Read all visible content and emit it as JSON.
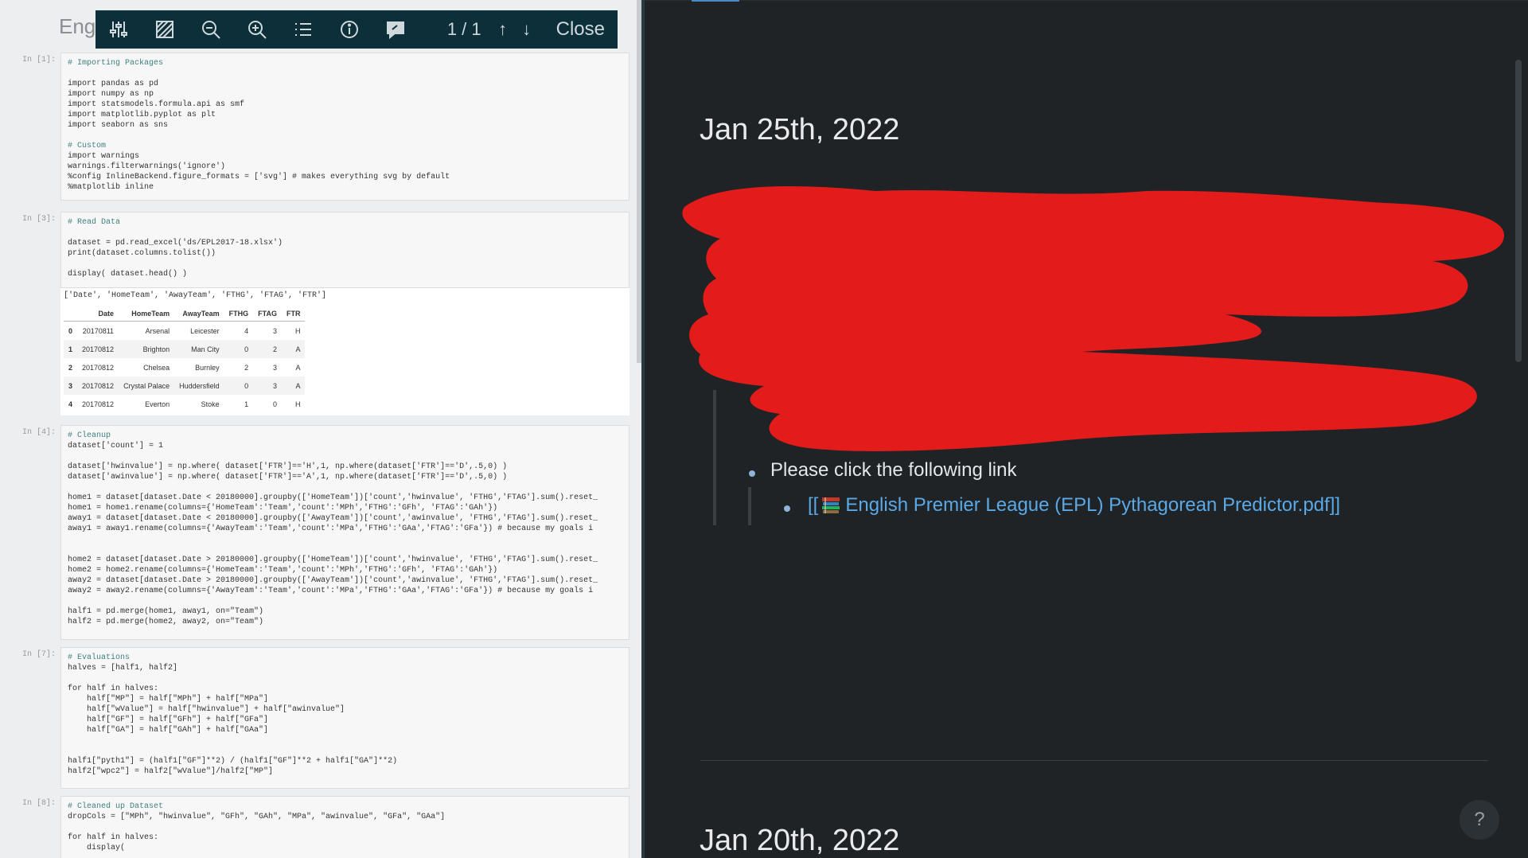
{
  "pdf_viewer": {
    "doc_title": "Engl",
    "toolbar": {
      "icons": [
        "sliders-icon",
        "highlighter-icon",
        "zoom-out-icon",
        "zoom-in-icon",
        "outline-icon",
        "info-icon",
        "comment-icon"
      ],
      "page_indicator": "1 / 1",
      "prev_label": "↑",
      "next_label": "↓",
      "close_label": "Close"
    },
    "cells": [
      {
        "prompt": "In [1]:",
        "lines": [
          "# Importing Packages",
          "",
          "import pandas as pd",
          "import numpy as np",
          "import statsmodels.formula.api as smf",
          "import matplotlib.pyplot as plt",
          "import seaborn as sns",
          "",
          "# Custom",
          "import warnings",
          "warnings.filterwarnings('ignore')",
          "%config InlineBackend.figure_formats = ['svg'] # makes everything svg by default",
          "%matplotlib inline"
        ]
      },
      {
        "prompt": "In [3]:",
        "lines": [
          "# Read Data",
          "",
          "dataset = pd.read_excel('ds/EPL2017-18.xlsx')",
          "print(dataset.columns.tolist())",
          "",
          "display( dataset.head() )"
        ]
      },
      {
        "prompt": "In [4]:",
        "lines": [
          "# Cleanup",
          "dataset['count'] = 1",
          "",
          "dataset['hwinvalue'] = np.where( dataset['FTR']=='H',1, np.where(dataset['FTR']=='D',.5,0) )",
          "dataset['awinvalue'] = np.where( dataset['FTR']=='A',1, np.where(dataset['FTR']=='D',.5,0) )",
          "",
          "home1 = dataset[dataset.Date < 20180000].groupby(['HomeTeam'])['count','hwinvalue', 'FTHG','FTAG'].sum().reset_",
          "home1 = home1.rename(columns={'HomeTeam':'Team','count':'MPh','FTHG':'GFh', 'FTAG':'GAh'})",
          "away1 = dataset[dataset.Date < 20180000].groupby(['AwayTeam'])['count','awinvalue', 'FTHG','FTAG'].sum().reset_",
          "away1 = away1.rename(columns={'AwayTeam':'Team','count':'MPa','FTHG':'GAa','FTAG':'GFa'}) # because my goals i",
          "",
          "",
          "home2 = dataset[dataset.Date > 20180000].groupby(['HomeTeam'])['count','hwinvalue', 'FTHG','FTAG'].sum().reset_",
          "home2 = home2.rename(columns={'HomeTeam':'Team','count':'MPh','FTHG':'GFh', 'FTAG':'GAh'})",
          "away2 = dataset[dataset.Date > 20180000].groupby(['AwayTeam'])['count','awinvalue', 'FTHG','FTAG'].sum().reset_",
          "away2 = away2.rename(columns={'AwayTeam':'Team','count':'MPa','FTHG':'GAa','FTAG':'GFa'}) # because my goals i",
          "",
          "half1 = pd.merge(home1, away1, on=\"Team\")",
          "half2 = pd.merge(home2, away2, on=\"Team\")"
        ]
      },
      {
        "prompt": "In [7]:",
        "lines": [
          "# Evaluations",
          "halves = [half1, half2]",
          "",
          "for half in halves:",
          "    half[\"MP\"] = half[\"MPh\"] + half[\"MPa\"]",
          "    half[\"wValue\"] = half[\"hwinvalue\"] + half[\"awinvalue\"]",
          "    half[\"GF\"] = half[\"GFh\"] + half[\"GFa\"]",
          "    half[\"GA\"] = half[\"GAh\"] + half[\"GAa\"]",
          "",
          "",
          "half1[\"pyth1\"] = (half1[\"GF\"]**2) / (half1[\"GF\"]**2 + half1[\"GA\"]**2)",
          "half2[\"wpc2\"] = half2[\"wValue\"]/half2[\"MP\"]"
        ]
      },
      {
        "prompt": "In [8]:",
        "lines": [
          "# Cleaned up Dataset",
          "dropCols = [\"MPh\", \"hwinvalue\", \"GFh\", \"GAh\", \"MPa\", \"awinvalue\", \"GFa\", \"GAa\"]",
          "",
          "for half in halves:",
          "    display("
        ]
      }
    ],
    "print_output": "['Date', 'HomeTeam', 'AwayTeam', 'FTHG', 'FTAG', 'FTR']",
    "dataframe": {
      "columns": [
        "",
        "Date",
        "HomeTeam",
        "AwayTeam",
        "FTHG",
        "FTAG",
        "FTR"
      ],
      "rows": [
        [
          "0",
          "20170811",
          "Arsenal",
          "Leicester",
          "4",
          "3",
          "H"
        ],
        [
          "1",
          "20170812",
          "Brighton",
          "Man City",
          "0",
          "2",
          "A"
        ],
        [
          "2",
          "20170812",
          "Chelsea",
          "Burnley",
          "2",
          "3",
          "A"
        ],
        [
          "3",
          "20170812",
          "Crystal Palace",
          "Huddersfield",
          "0",
          "3",
          "A"
        ],
        [
          "4",
          "20170812",
          "Everton",
          "Stoke",
          "1",
          "0",
          "H"
        ]
      ]
    }
  },
  "notes": {
    "journal1_title": "Jan 25th, 2022",
    "block1_text": "Please click the following link",
    "block2_link": {
      "prefix": "[[",
      "icon": "books-icon",
      "text": "English Premier League (EPL) Pythagorean Predictor.pdf",
      "suffix": "]]"
    },
    "journal2_title": "Jan 20th, 2022",
    "help_label": "?",
    "colors": {
      "background": "#1f2326",
      "link": "#5aa9e6",
      "redaction": "#e31b1b",
      "toolbar": "#0d2f39"
    }
  }
}
